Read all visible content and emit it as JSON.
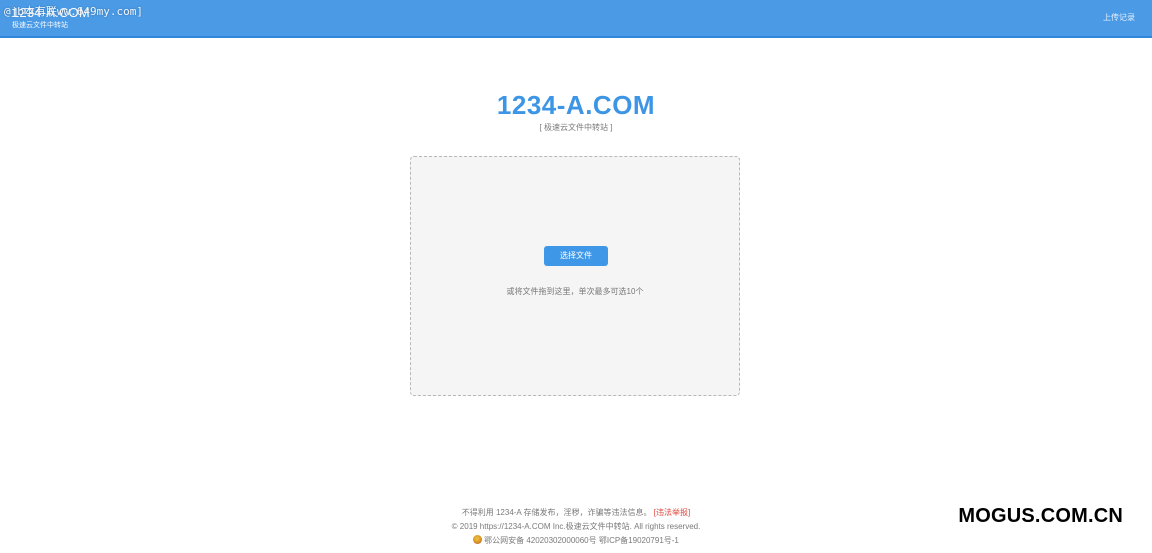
{
  "header": {
    "brand_title": "1234-A.COM",
    "brand_subtitle": "极速云文件中转站",
    "watermark": "@jb本有联ww.649my.com]",
    "upload_history": "上传记录"
  },
  "hero": {
    "title": "1234-A.COM",
    "subtitle": "[ 极速云文件中转站 ]"
  },
  "dropzone": {
    "select_button": "选择文件",
    "hint": "或将文件拖到这里，单次最多可选10个"
  },
  "footer": {
    "notice": "不得利用 1234-A 存储发布，淫秽，诈骗等违法信息。",
    "report_link": "[违法举报]",
    "copyright": "© 2019 https://1234-A.COM Inc.极速云文件中转站. All rights reserved.",
    "icp": "鄂公网安备 42020302000060号 鄂ICP备19020791号-1"
  },
  "watermark_bottom": "MOGUS.COM.CN",
  "colors": {
    "topbar": "#4a9ae6",
    "accent": "#3d95e5",
    "button": "#3f97e8",
    "report": "#e0473f"
  }
}
